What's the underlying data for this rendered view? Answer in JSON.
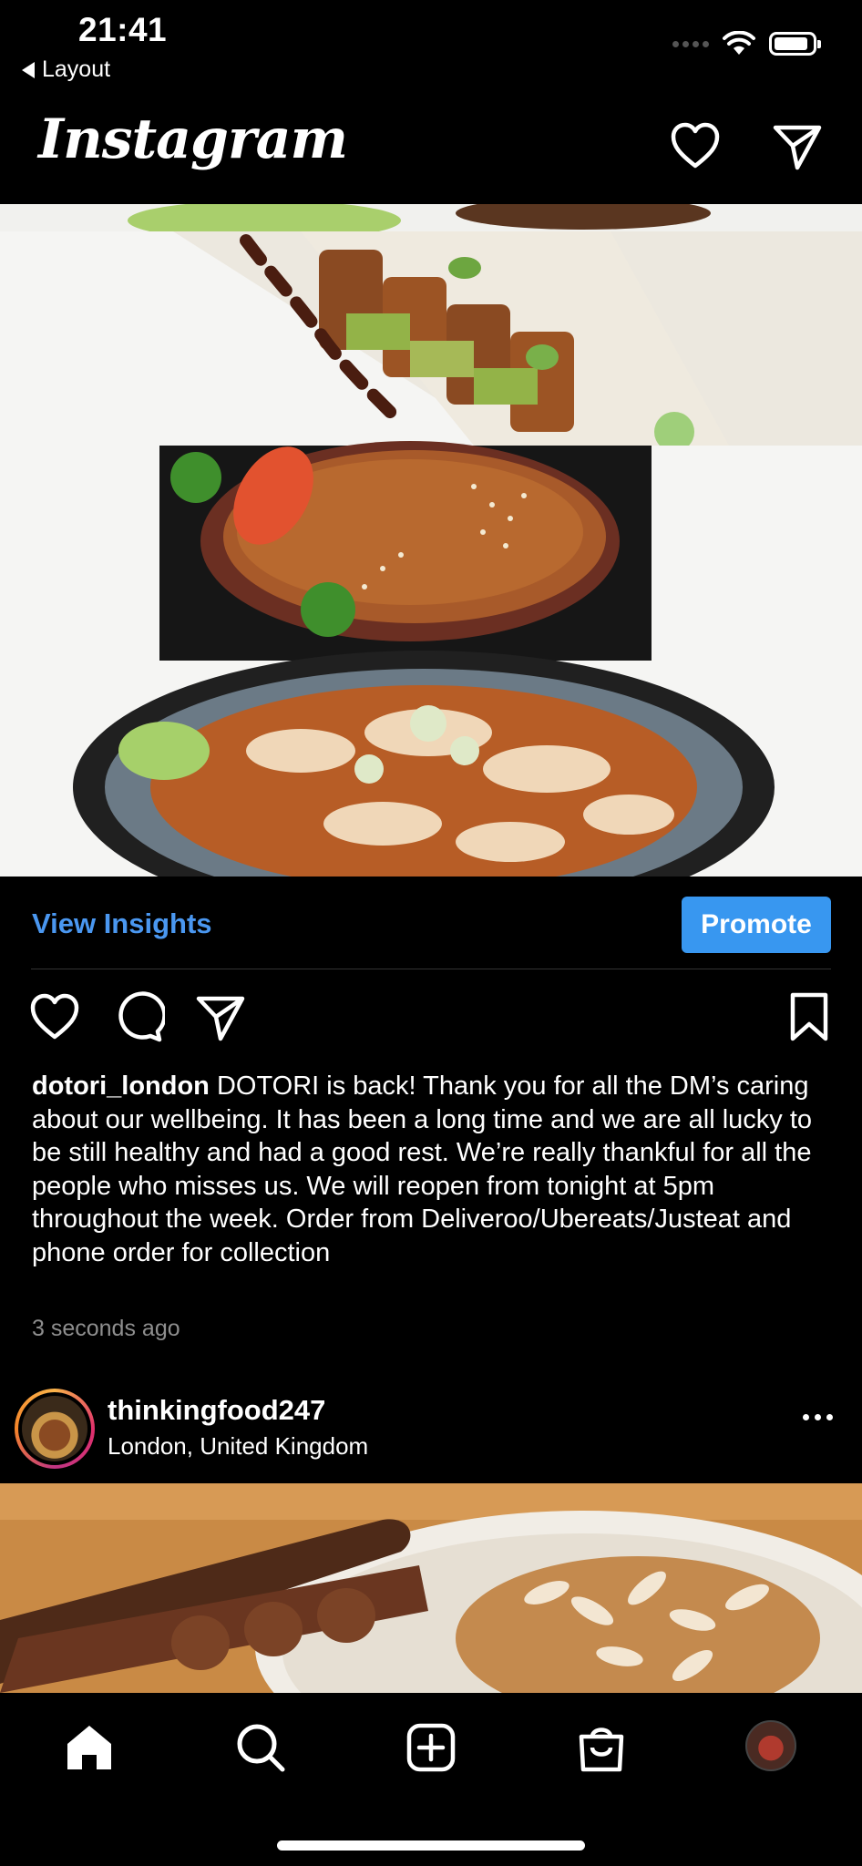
{
  "status_bar": {
    "time": "21:41",
    "back_label": "Layout"
  },
  "header": {
    "logo": "Instagram",
    "icons": [
      "heart-icon",
      "direct-message-icon"
    ]
  },
  "post": {
    "image_alt": "food collage",
    "view_insights_label": "View Insights",
    "promote_label": "Promote",
    "actions": [
      "like-icon",
      "comment-icon",
      "share-icon",
      "save-icon"
    ],
    "caption_username": "dotori_london",
    "caption_text": "DOTORI is back! Thank you for all the DM’s caring about our wellbeing. It has been a long time and we are all lucky to be still healthy and had a good rest. We’re really thankful for all the people who misses us. We will reopen from tonight at 5pm throughout the week. Order from Deliveroo/Ubereats/Justeat and phone order for collection",
    "timestamp": "3 seconds ago"
  },
  "next_post": {
    "username": "thinkingfood247",
    "location": "London, United Kingdom"
  },
  "tab_bar": {
    "items": [
      "home-icon",
      "search-icon",
      "new-post-icon",
      "shop-icon",
      "profile-avatar"
    ]
  },
  "colors": {
    "background": "#000000",
    "link_blue": "#4a97f0",
    "button_blue": "#3897f0",
    "muted": "#8e8e8e"
  }
}
